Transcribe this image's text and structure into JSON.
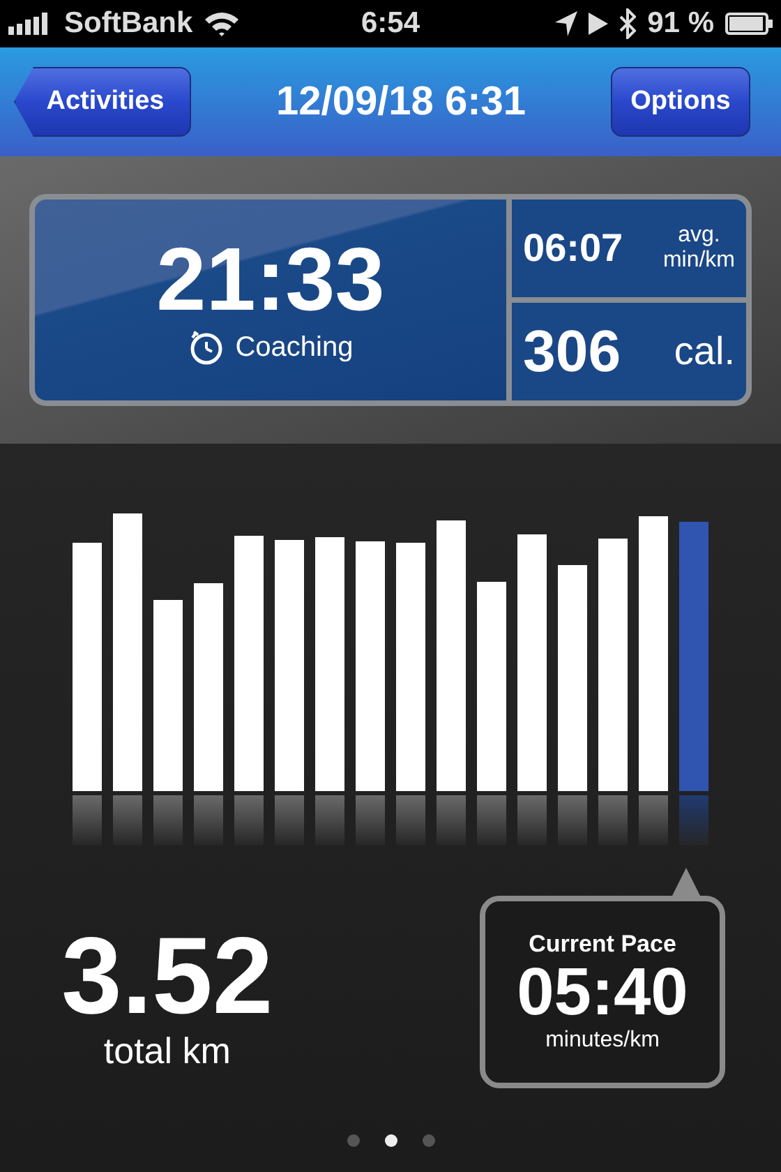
{
  "status_bar": {
    "carrier": "SoftBank",
    "time": "6:54",
    "battery": "91 %"
  },
  "nav_bar": {
    "back_button": "Activities",
    "title": "12/09/18 6:31",
    "options_button": "Options"
  },
  "summary": {
    "duration": "21:33",
    "coaching": "Coaching",
    "avg_pace": "06:07",
    "avg_label_1": "avg.",
    "avg_label_2": "min/km",
    "calories": "306",
    "calories_unit": "cal."
  },
  "split_bars": [
    {
      "selected": false
    },
    {
      "selected": false
    },
    {
      "selected": false
    },
    {
      "selected": false
    },
    {
      "selected": false
    },
    {
      "selected": false
    },
    {
      "selected": false
    },
    {
      "selected": false
    },
    {
      "selected": false
    },
    {
      "selected": false
    },
    {
      "selected": false
    },
    {
      "selected": false
    },
    {
      "selected": false
    },
    {
      "selected": false
    },
    {
      "selected": false
    },
    {
      "selected": true
    }
  ],
  "distance": {
    "value": "3.52",
    "unit": "total km"
  },
  "current_pace": {
    "label": "Current Pace",
    "value": "05:40",
    "unit": "minutes/km"
  },
  "pages": [
    {
      "selected": false
    },
    {
      "selected": true
    },
    {
      "selected": false
    }
  ]
}
